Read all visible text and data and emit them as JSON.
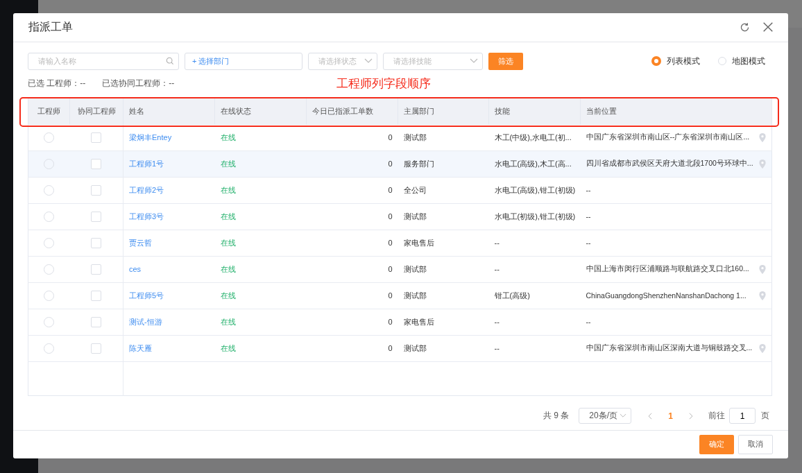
{
  "dialog": {
    "title": "指派工单"
  },
  "filters": {
    "name_search": {
      "placeholder": "请输入名称"
    },
    "department_button": "+ 选择部门",
    "status_select": {
      "placeholder": "请选择状态"
    },
    "skill_select": {
      "placeholder": "请选择技能"
    },
    "filter_button": "筛选"
  },
  "view_modes": [
    {
      "label": "列表模式",
      "selected": true
    },
    {
      "label": "地图模式",
      "selected": false
    }
  ],
  "selection_summary": [
    {
      "label": "已选 工程师：",
      "value": "--"
    },
    {
      "label": "已选协同工程师：",
      "value": "--"
    }
  ],
  "annotation": {
    "text": "工程师列字段顺序"
  },
  "table": {
    "columns": [
      "工程师",
      "协同工程师",
      "姓名",
      "在线状态",
      "今日已指派工单数",
      "主属部门",
      "技能",
      "当前位置"
    ],
    "rows": [
      {
        "selected": false,
        "checked": false,
        "highlighted": false,
        "name": "梁炯丰Entey",
        "status": "在线",
        "assigned_today": "0",
        "department": "测试部",
        "skills": "木工(中级),水电工(初...",
        "location": "中国广东省深圳市南山区--广东省深圳市南山区...",
        "pin": true
      },
      {
        "selected": false,
        "checked": false,
        "highlighted": true,
        "name": "工程师1号",
        "status": "在线",
        "assigned_today": "0",
        "department": "服务部门",
        "skills": "水电工(高级),木工(高...",
        "location": "四川省成都市武侯区天府大道北段1700号环球中...",
        "pin": true
      },
      {
        "selected": false,
        "checked": false,
        "highlighted": false,
        "name": "工程师2号",
        "status": "在线",
        "assigned_today": "0",
        "department": "全公司",
        "skills": "水电工(高级),钳工(初级)",
        "location": "--",
        "pin": false
      },
      {
        "selected": false,
        "checked": false,
        "highlighted": false,
        "name": "工程师3号",
        "status": "在线",
        "assigned_today": "0",
        "department": "测试部",
        "skills": "水电工(初级),钳工(初级)",
        "location": "--",
        "pin": false
      },
      {
        "selected": false,
        "checked": false,
        "highlighted": false,
        "name": "贾云哲",
        "status": "在线",
        "assigned_today": "0",
        "department": "家电售后",
        "skills": "--",
        "location": "--",
        "pin": false
      },
      {
        "selected": false,
        "checked": false,
        "highlighted": false,
        "name": "ces",
        "status": "在线",
        "assigned_today": "0",
        "department": "测试部",
        "skills": "--",
        "location": "中国上海市闵行区浦顺路与联航路交叉口北160...",
        "pin": true
      },
      {
        "selected": false,
        "checked": false,
        "highlighted": false,
        "name": "工程师5号",
        "status": "在线",
        "assigned_today": "0",
        "department": "测试部",
        "skills": "钳工(高级)",
        "location": "ChinaGuangdongShenzhenNanshanDachong 1...",
        "pin": true
      },
      {
        "selected": false,
        "checked": false,
        "highlighted": false,
        "name": "测试-恒游",
        "status": "在线",
        "assigned_today": "0",
        "department": "家电售后",
        "skills": "--",
        "location": "--",
        "pin": false
      },
      {
        "selected": false,
        "checked": false,
        "highlighted": false,
        "name": "陈天雁",
        "status": "在线",
        "assigned_today": "0",
        "department": "测试部",
        "skills": "--",
        "location": "中国广东省深圳市南山区深南大道与铜鼓路交叉...",
        "pin": true
      }
    ]
  },
  "pagination": {
    "total": "共 9 条",
    "page_size": "20条/页",
    "pages": [
      {
        "label": "1",
        "selected": true
      }
    ],
    "goto_label": "前往",
    "goto_value": "1",
    "page_unit": "页"
  },
  "footer_buttons": [
    {
      "label": "确定",
      "kind": "primary"
    },
    {
      "label": "取消",
      "kind": "default"
    }
  ]
}
